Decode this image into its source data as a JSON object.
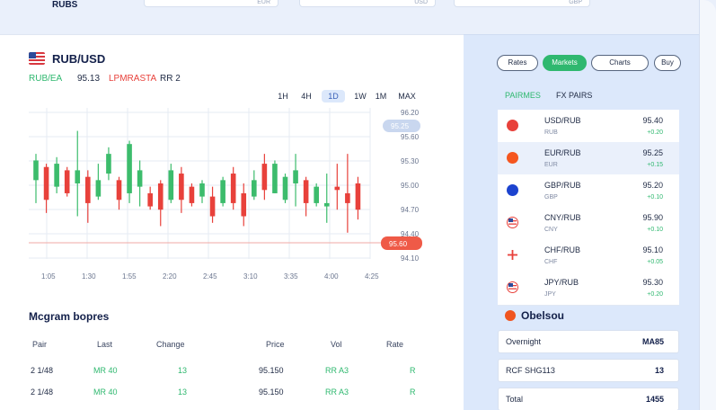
{
  "app": {
    "brand": "RUBS"
  },
  "top_pills": [
    "EUR",
    "USD",
    "GBP"
  ],
  "pair": {
    "name": "RUB/USD",
    "quote_bid": "RUB/EA",
    "quote_ask": "95.13",
    "quote_change": "LPMRASTA",
    "quote_vol": "RR 2"
  },
  "timeframes": [
    "1H",
    "4H",
    "1D",
    "1W",
    "1M",
    "MAX"
  ],
  "timeframe_active": 2,
  "markers": {
    "last": "95.25",
    "current": "95.60"
  },
  "colors": {
    "up": "#3cbc6c",
    "down": "#e8413b",
    "accent": "#2fb86f"
  },
  "chart_data": {
    "type": "candlestick",
    "y_labels": [
      "96.20",
      "95.60",
      "95.30",
      "95.00",
      "94.70",
      "94.40",
      "94.10"
    ],
    "x_labels": [
      "1:05",
      "1:30",
      "1:55",
      "2:20",
      "2:45",
      "3:10",
      "3:35",
      "4:00",
      "4:25"
    ],
    "candles": [
      {
        "o": 95.2,
        "h": 95.6,
        "l": 94.85,
        "c": 95.5
      },
      {
        "o": 95.4,
        "h": 95.45,
        "l": 94.7,
        "c": 94.9
      },
      {
        "o": 95.1,
        "h": 95.55,
        "l": 95.0,
        "c": 95.45
      },
      {
        "o": 95.35,
        "h": 95.4,
        "l": 94.95,
        "c": 95.0
      },
      {
        "o": 95.15,
        "h": 95.95,
        "l": 94.65,
        "c": 95.35
      },
      {
        "o": 95.25,
        "h": 95.35,
        "l": 94.55,
        "c": 94.85
      },
      {
        "o": 94.95,
        "h": 95.45,
        "l": 94.9,
        "c": 95.2
      },
      {
        "o": 95.3,
        "h": 95.7,
        "l": 95.2,
        "c": 95.6
      },
      {
        "o": 95.2,
        "h": 95.25,
        "l": 94.75,
        "c": 94.9
      },
      {
        "o": 95.0,
        "h": 95.8,
        "l": 94.85,
        "c": 95.75
      },
      {
        "o": 95.1,
        "h": 95.5,
        "l": 94.8,
        "c": 95.35
      },
      {
        "o": 95.0,
        "h": 95.1,
        "l": 94.75,
        "c": 94.8
      },
      {
        "o": 95.15,
        "h": 95.2,
        "l": 94.5,
        "c": 94.75
      },
      {
        "o": 94.9,
        "h": 95.45,
        "l": 94.85,
        "c": 95.35
      },
      {
        "o": 95.3,
        "h": 95.4,
        "l": 94.7,
        "c": 94.9
      },
      {
        "o": 95.1,
        "h": 95.15,
        "l": 94.8,
        "c": 94.85
      },
      {
        "o": 94.95,
        "h": 95.2,
        "l": 94.85,
        "c": 95.15
      },
      {
        "o": 94.95,
        "h": 95.1,
        "l": 94.55,
        "c": 94.65
      },
      {
        "o": 94.85,
        "h": 95.25,
        "l": 94.8,
        "c": 95.2
      },
      {
        "o": 95.3,
        "h": 95.4,
        "l": 94.75,
        "c": 94.85
      },
      {
        "o": 95.0,
        "h": 95.15,
        "l": 94.5,
        "c": 94.65
      },
      {
        "o": 94.95,
        "h": 95.35,
        "l": 94.9,
        "c": 95.2
      },
      {
        "o": 95.45,
        "h": 95.6,
        "l": 94.9,
        "c": 95.05
      },
      {
        "o": 95.0,
        "h": 95.5,
        "l": 95.0,
        "c": 95.45
      },
      {
        "o": 94.9,
        "h": 95.3,
        "l": 94.85,
        "c": 95.25
      },
      {
        "o": 95.15,
        "h": 95.6,
        "l": 94.8,
        "c": 95.35
      },
      {
        "o": 95.2,
        "h": 95.25,
        "l": 94.65,
        "c": 94.85
      },
      {
        "o": 94.85,
        "h": 95.15,
        "l": 94.8,
        "c": 95.1
      },
      {
        "o": 94.8,
        "h": 95.3,
        "l": 94.55,
        "c": 94.85
      },
      {
        "o": 95.1,
        "h": 95.45,
        "l": 94.75,
        "c": 95.05
      },
      {
        "o": 95.0,
        "h": 95.6,
        "l": 94.4,
        "c": 94.85
      },
      {
        "o": 95.15,
        "h": 95.25,
        "l": 94.6,
        "c": 94.75
      }
    ],
    "ylim": [
      94.0,
      96.3
    ]
  },
  "orders": {
    "title": "Mcgram bopres",
    "headers": [
      "Pair",
      "Last",
      "Change",
      "Price",
      "Vol",
      "Rate"
    ],
    "rows": [
      [
        "2 1/48",
        "MR 40",
        "13",
        "95.150",
        "RR A3",
        "R"
      ],
      [
        "2 1/48",
        "MR 40",
        "13",
        "95.150",
        "RR A3",
        "R"
      ]
    ]
  },
  "right_tabs": [
    "Rates",
    "Markets",
    "Charts",
    "Buy"
  ],
  "right_tab_active": 1,
  "watchlist": {
    "header_main": "PAIRMES",
    "header_alt": "FX PAIRS",
    "items": [
      {
        "name": "USD/RUB",
        "sub": "RUB",
        "price": "95.40",
        "change": "+0.20",
        "icon_color": "#e8413b",
        "icon_glyph": ""
      },
      {
        "name": "EUR/RUB",
        "sub": "EUR",
        "price": "95.25",
        "change": "+0.15",
        "icon_color": "#f5561f",
        "icon_glyph": ""
      },
      {
        "name": "GBP/RUB",
        "sub": "GBP",
        "price": "95.20",
        "change": "+0.10",
        "icon_color": "#1c43cf",
        "icon_glyph": ""
      },
      {
        "name": "CNY/RUB",
        "sub": "CNY",
        "price": "95.90",
        "change": "+0.10",
        "icon_color": "#ffffff",
        "icon_glyph": "us-flag"
      },
      {
        "name": "CHF/RUB",
        "sub": "CHF",
        "price": "95.10",
        "change": "+0.05",
        "icon_color": "#ffffff",
        "icon_glyph": "swiss-cross"
      },
      {
        "name": "JPY/RUB",
        "sub": "JPY",
        "price": "95.30",
        "change": "+0.20",
        "icon_color": "#ffffff",
        "icon_glyph": "us-flag"
      }
    ]
  },
  "summary": {
    "title": "Obelsou",
    "rows": [
      {
        "label": "Overnight",
        "value": "MA85"
      },
      {
        "label": "RCF SHG113",
        "value": "13"
      },
      {
        "label": "Total",
        "value": "1455"
      }
    ]
  }
}
